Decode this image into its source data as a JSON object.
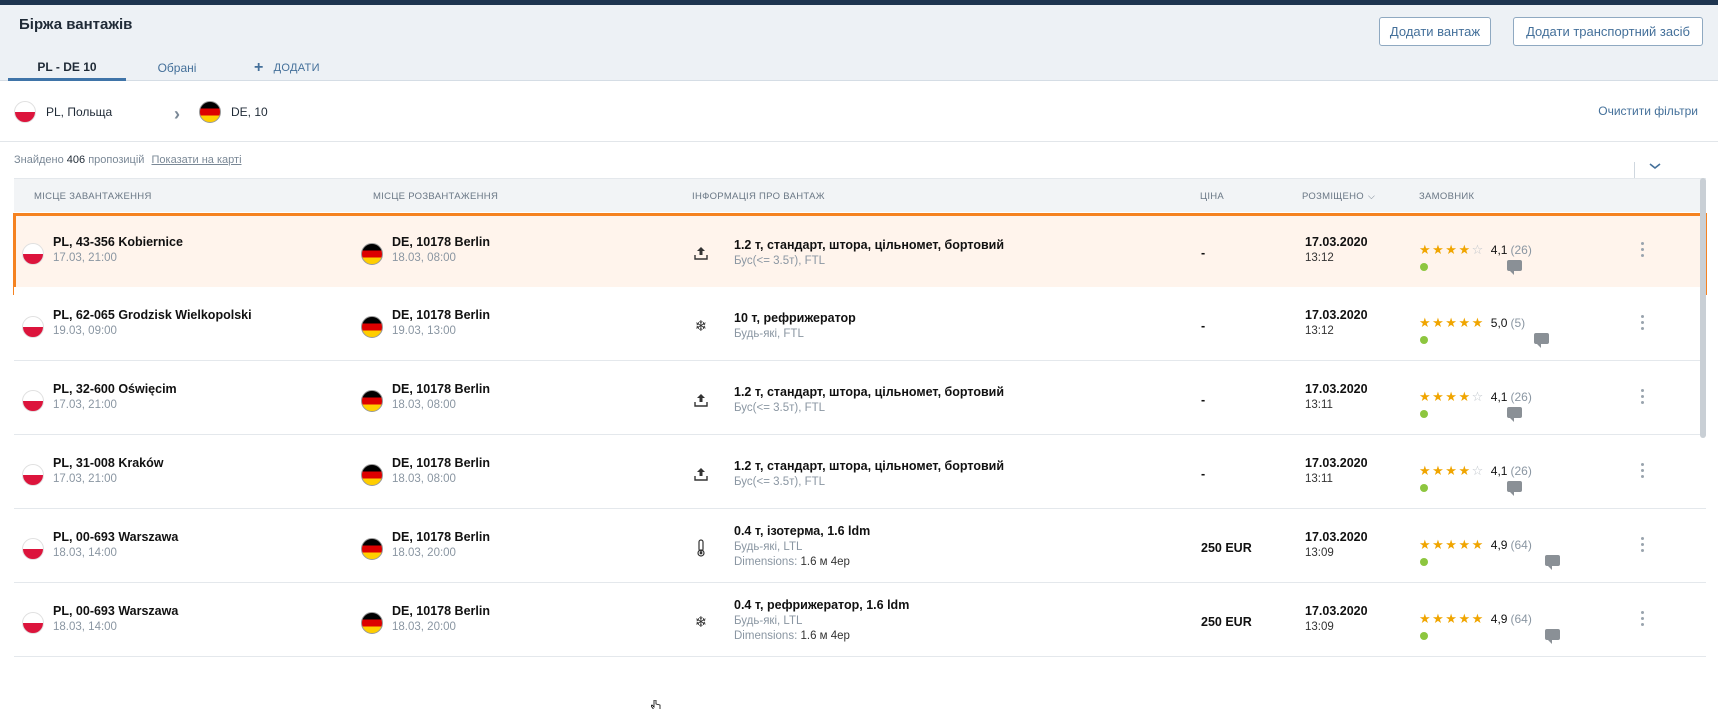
{
  "header": {
    "title": "Біржа вантажів",
    "add_cargo": "Додати вантаж",
    "add_vehicle": "Додати транспортний засіб"
  },
  "tabs": [
    {
      "label": "PL - DE 10",
      "active": true
    },
    {
      "label": "Обрані",
      "active": false
    },
    {
      "label": "ДОДАТИ",
      "active": false
    }
  ],
  "filters": {
    "from": "PL, Польща",
    "to": "DE, 10",
    "clear": "Очистити фільтри"
  },
  "results": {
    "prefix": "Знайдено",
    "count": "406",
    "suffix": "пропозицій",
    "map_link": "Показати на карті"
  },
  "columns": {
    "loading": "Місце завантаження",
    "unloading": "Місце розвантаження",
    "cargo": "Інформація про вантаж",
    "price": "Ціна",
    "posted": "Розміщено",
    "customer": "Замовник"
  },
  "rows": [
    {
      "from": "PL, 43-356 Kobiernice",
      "from_date": "17.03, 21:00",
      "to": "DE, 10178 Berlin",
      "to_date": "18.03, 08:00",
      "icon": "upload-icon",
      "cargo": "1.2 т, стандарт, штора, цільномет, бортовий",
      "cargo_sub": "Бус(<= 3.5т), FTL",
      "dims_label": "",
      "dims": "",
      "price": "-",
      "posted_date": "17.03.2020",
      "posted_time": "13:12",
      "stars": 4,
      "rating": "4,1",
      "reviews": "(26)"
    },
    {
      "from": "PL, 62-065 Grodzisk Wielkopolski",
      "from_date": "19.03, 09:00",
      "to": "DE, 10178 Berlin",
      "to_date": "19.03, 13:00",
      "icon": "snowflake-icon",
      "cargo": "10 т, рефрижератор",
      "cargo_sub": "Будь-які, FTL",
      "dims_label": "",
      "dims": "",
      "price": "-",
      "posted_date": "17.03.2020",
      "posted_time": "13:12",
      "stars": 5,
      "rating": "5,0",
      "reviews": "(5)"
    },
    {
      "from": "PL, 32-600 Oświęcim",
      "from_date": "17.03, 21:00",
      "to": "DE, 10178 Berlin",
      "to_date": "18.03, 08:00",
      "icon": "upload-icon",
      "cargo": "1.2 т, стандарт, штора, цільномет, бортовий",
      "cargo_sub": "Бус(<= 3.5т), FTL",
      "dims_label": "",
      "dims": "",
      "price": "-",
      "posted_date": "17.03.2020",
      "posted_time": "13:11",
      "stars": 4,
      "rating": "4,1",
      "reviews": "(26)"
    },
    {
      "from": "PL, 31-008 Kraków",
      "from_date": "17.03, 21:00",
      "to": "DE, 10178 Berlin",
      "to_date": "18.03, 08:00",
      "icon": "upload-icon",
      "cargo": "1.2 т, стандарт, штора, цільномет, бортовий",
      "cargo_sub": "Бус(<= 3.5т), FTL",
      "dims_label": "",
      "dims": "",
      "price": "-",
      "posted_date": "17.03.2020",
      "posted_time": "13:11",
      "stars": 4,
      "rating": "4,1",
      "reviews": "(26)"
    },
    {
      "from": "PL, 00-693 Warszawa",
      "from_date": "18.03, 14:00",
      "to": "DE, 10178 Berlin",
      "to_date": "18.03, 20:00",
      "icon": "thermometer-icon",
      "cargo": "0.4 т, ізотерма, 1.6 ldm",
      "cargo_sub": "Будь-які, LTL",
      "dims_label": "Dimensions:",
      "dims": "1.6 м 4ep",
      "price": "250 EUR",
      "posted_date": "17.03.2020",
      "posted_time": "13:09",
      "stars": 5,
      "rating": "4,9",
      "reviews": "(64)"
    },
    {
      "from": "PL, 00-693 Warszawa",
      "from_date": "18.03, 14:00",
      "to": "DE, 10178 Berlin",
      "to_date": "18.03, 20:00",
      "icon": "snowflake-icon",
      "cargo": "0.4 т, рефрижератор, 1.6 ldm",
      "cargo_sub": "Будь-які, LTL",
      "dims_label": "Dimensions:",
      "dims": "1.6 м 4ep",
      "price": "250 EUR",
      "posted_date": "17.03.2020",
      "posted_time": "13:09",
      "stars": 5,
      "rating": "4,9",
      "reviews": "(64)"
    }
  ],
  "colors": {
    "selection": "#f58220",
    "accent": "#44709a",
    "star": "#f0a500",
    "online": "#8dc63f"
  }
}
